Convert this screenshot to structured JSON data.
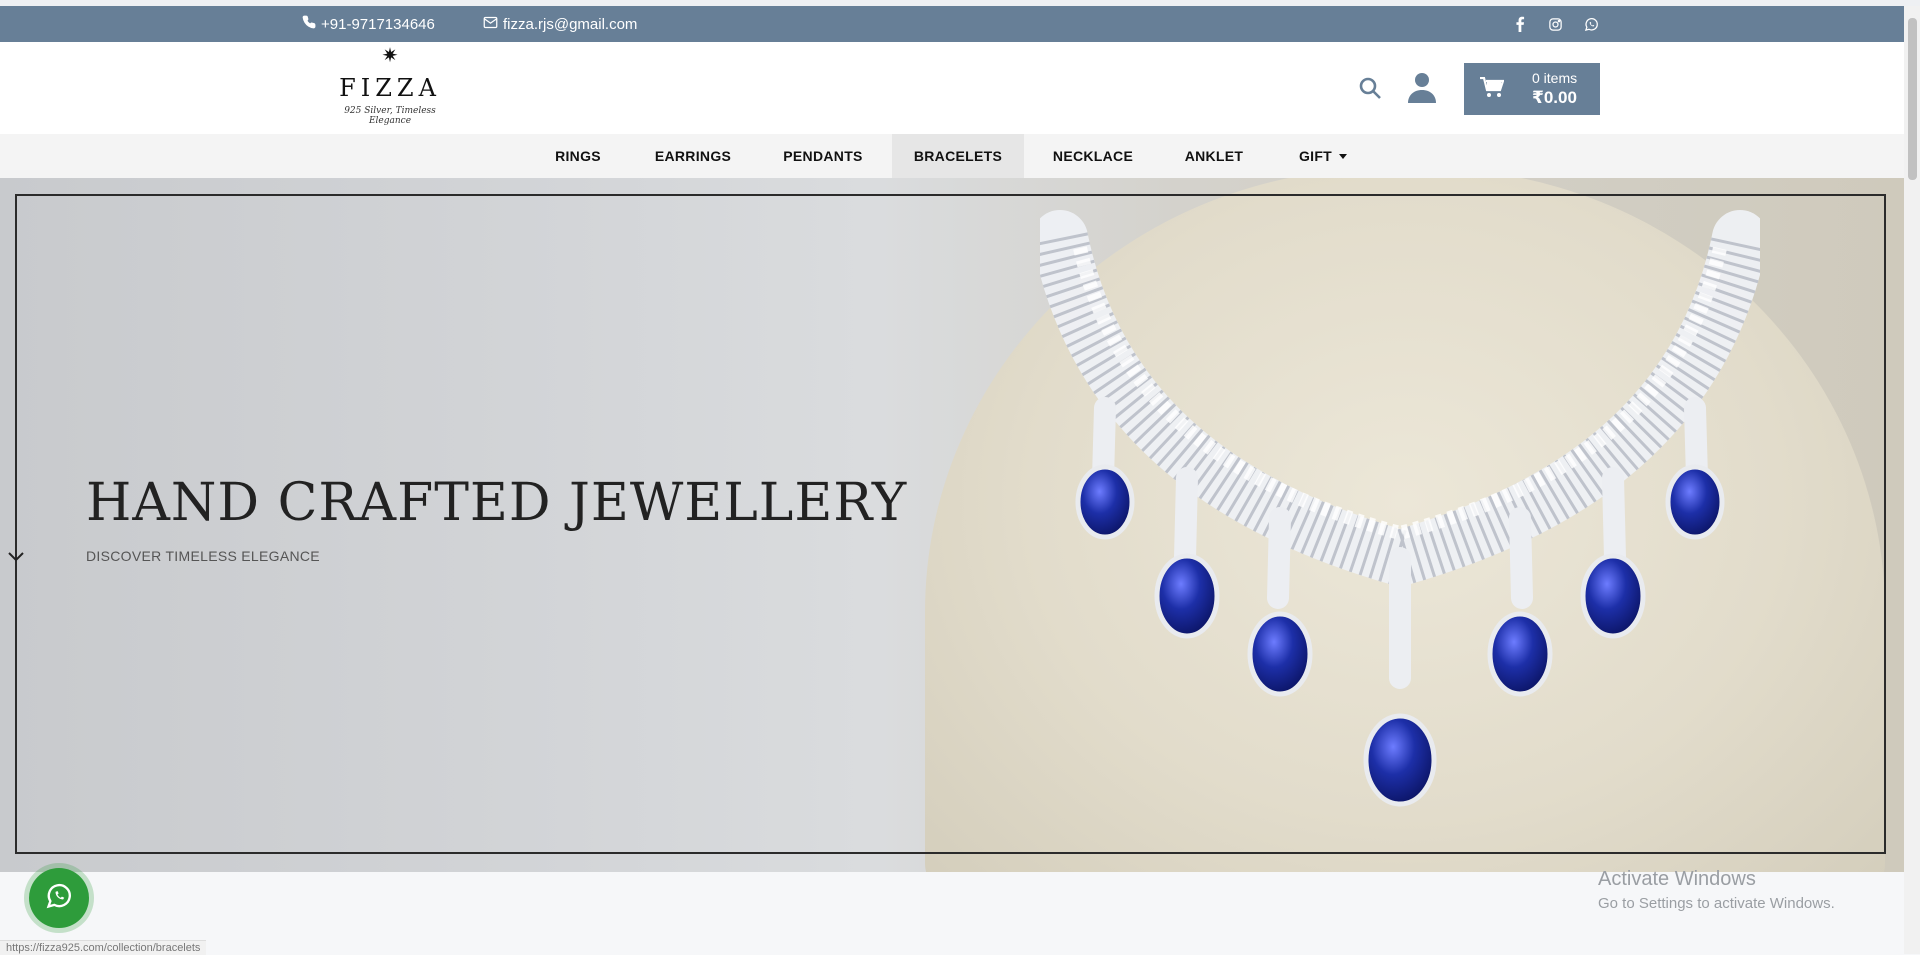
{
  "topbar": {
    "phone": "+91-9717134646",
    "email": "fizza.rjs@gmail.com",
    "social_icons": [
      "facebook-icon",
      "instagram-icon",
      "whatsapp-icon"
    ]
  },
  "header": {
    "logo": {
      "brand": "FIZZA",
      "tagline": "925 Silver, Timeless Elegance"
    },
    "cart": {
      "items": "0 items",
      "total": "₹0.00"
    }
  },
  "nav": {
    "items": [
      {
        "label": "RINGS"
      },
      {
        "label": "EARRINGS"
      },
      {
        "label": "PENDANTS"
      },
      {
        "label": "BRACELETS",
        "active": true
      },
      {
        "label": "NECKLACE"
      },
      {
        "label": "ANKLET"
      },
      {
        "label": "GIFT",
        "dropdown": true
      }
    ]
  },
  "hero": {
    "title": "HAND CRAFTED JEWELLERY",
    "subtitle": "DISCOVER TIMELESS ELEGANCE"
  },
  "overlay": {
    "activate_title": "Activate Windows",
    "activate_sub": "Go to Settings to activate Windows."
  },
  "status_url": "https://fizza925.com/collection/bracelets",
  "colors": {
    "topbar": "#677f97",
    "cart": "#677f97",
    "whatsapp": "#2e9c3b",
    "sapphire": "#1d2fa8"
  }
}
